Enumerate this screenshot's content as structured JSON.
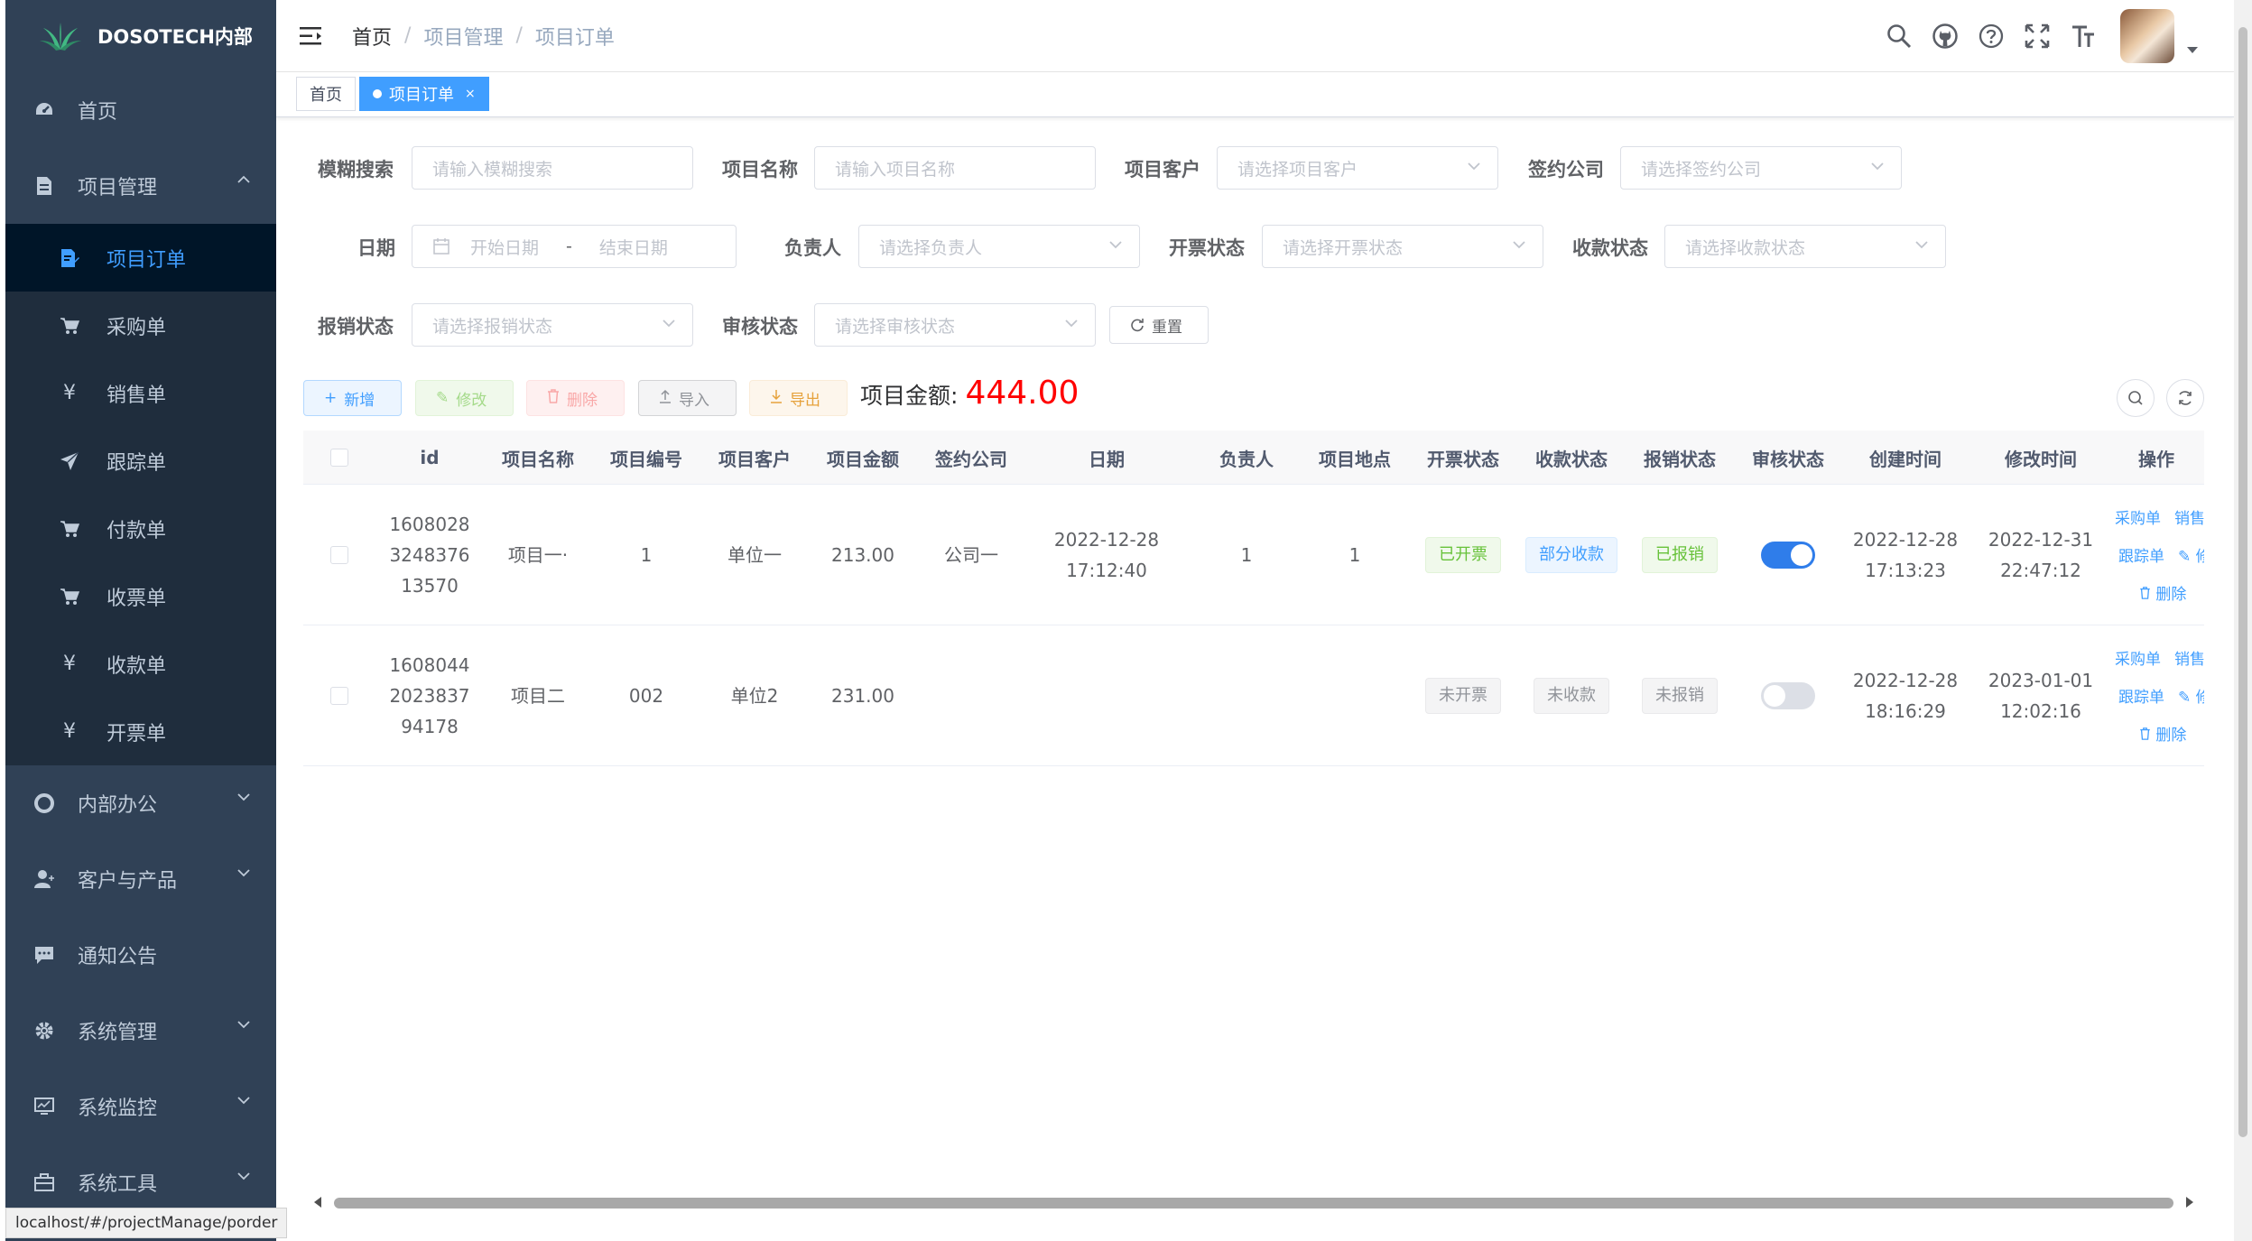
{
  "sidebar": {
    "logo": "DOSOTECH内部",
    "items": [
      {
        "label": "首页",
        "icon": "dashboard-icon"
      },
      {
        "label": "项目管理",
        "icon": "document-icon",
        "expanded": true,
        "children": [
          {
            "label": "项目订单",
            "icon": "edit-doc-icon",
            "active": true
          },
          {
            "label": "采购单",
            "icon": "cart-icon"
          },
          {
            "label": "销售单",
            "icon": "yen-icon"
          },
          {
            "label": "跟踪单",
            "icon": "send-icon"
          },
          {
            "label": "付款单",
            "icon": "cart-icon"
          },
          {
            "label": "收票单",
            "icon": "cart-icon"
          },
          {
            "label": "收款单",
            "icon": "yen-icon"
          },
          {
            "label": "开票单",
            "icon": "yen-icon"
          }
        ]
      },
      {
        "label": "内部办公",
        "icon": "lifebuoy-icon"
      },
      {
        "label": "客户与产品",
        "icon": "user-icon"
      },
      {
        "label": "通知公告",
        "icon": "message-icon"
      },
      {
        "label": "系统管理",
        "icon": "gear-icon"
      },
      {
        "label": "系统监控",
        "icon": "monitor-icon"
      },
      {
        "label": "系统工具",
        "icon": "toolbox-icon"
      }
    ]
  },
  "navbar": {
    "breadcrumb": [
      "首页",
      "项目管理",
      "项目订单"
    ]
  },
  "tags": [
    {
      "label": "首页",
      "active": false
    },
    {
      "label": "项目订单",
      "active": true,
      "close": "×"
    }
  ],
  "search": {
    "fuzzy_label": "模糊搜索",
    "fuzzy_placeholder": "请输入模糊搜索",
    "name_label": "项目名称",
    "name_placeholder": "请输入项目名称",
    "customer_label": "项目客户",
    "customer_placeholder": "请选择项目客户",
    "company_label": "签约公司",
    "company_placeholder": "请选择签约公司",
    "date_label": "日期",
    "date_start": "开始日期",
    "date_sep": "-",
    "date_end": "结束日期",
    "owner_label": "负责人",
    "owner_placeholder": "请选择负责人",
    "invoice_label": "开票状态",
    "invoice_placeholder": "请选择开票状态",
    "payment_label": "收款状态",
    "payment_placeholder": "请选择收款状态",
    "reimburse_label": "报销状态",
    "reimburse_placeholder": "请选择报销状态",
    "audit_label": "审核状态",
    "audit_placeholder": "请选择审核状态",
    "reset_label": "重置"
  },
  "toolbar": {
    "add": "新增",
    "edit": "修改",
    "delete": "删除",
    "import": "导入",
    "export": "导出",
    "total_label": "项目金额:",
    "total_value": "444.00"
  },
  "table": {
    "columns": [
      "id",
      "项目名称",
      "项目编号",
      "项目客户",
      "项目金额",
      "签约公司",
      "日期",
      "负责人",
      "项目地点",
      "开票状态",
      "收款状态",
      "报销状态",
      "审核状态",
      "创建时间",
      "修改时间",
      "操作"
    ],
    "rows": [
      {
        "id": [
          "1608028",
          "3248376",
          "13570"
        ],
        "name": "项目一·",
        "code": "1",
        "customer": "单位一",
        "amount": "213.00",
        "company": "公司一",
        "date": [
          "2022-12-28",
          "17:12:40"
        ],
        "owner": "1",
        "location": "1",
        "invoice": {
          "text": "已开票",
          "type": "success"
        },
        "payment": {
          "text": "部分收款",
          "type": "primary"
        },
        "reimburse": {
          "text": "已报销",
          "type": "success"
        },
        "audit_on": true,
        "created": [
          "2022-12-28",
          "17:13:23"
        ],
        "modified": [
          "2022-12-31",
          "22:47:12"
        ],
        "ops": {
          "purchase": "采购单",
          "sales": "销售单",
          "track": "跟踪单",
          "edit": "修",
          "delete": "删除"
        }
      },
      {
        "id": [
          "1608044",
          "2023837",
          "94178"
        ],
        "name": "项目二",
        "code": "002",
        "customer": "单位2",
        "amount": "231.00",
        "company": "",
        "date": [
          "",
          ""
        ],
        "owner": "",
        "location": "",
        "invoice": {
          "text": "未开票",
          "type": "info"
        },
        "payment": {
          "text": "未收款",
          "type": "info"
        },
        "reimburse": {
          "text": "未报销",
          "type": "info"
        },
        "audit_on": false,
        "created": [
          "2022-12-28",
          "18:16:29"
        ],
        "modified": [
          "2023-01-01",
          "12:02:16"
        ],
        "ops": {
          "purchase": "采购单",
          "sales": "销售单",
          "track": "跟踪单",
          "edit": "修",
          "delete": "删除"
        }
      }
    ]
  },
  "status_url": "localhost/#/projectManage/porder",
  "colors": {
    "sidebar_bg": "#304156",
    "submenu_bg": "#1f2d3d",
    "active_bg": "#001528",
    "accent": "#409eff",
    "total": "#ff0000"
  }
}
